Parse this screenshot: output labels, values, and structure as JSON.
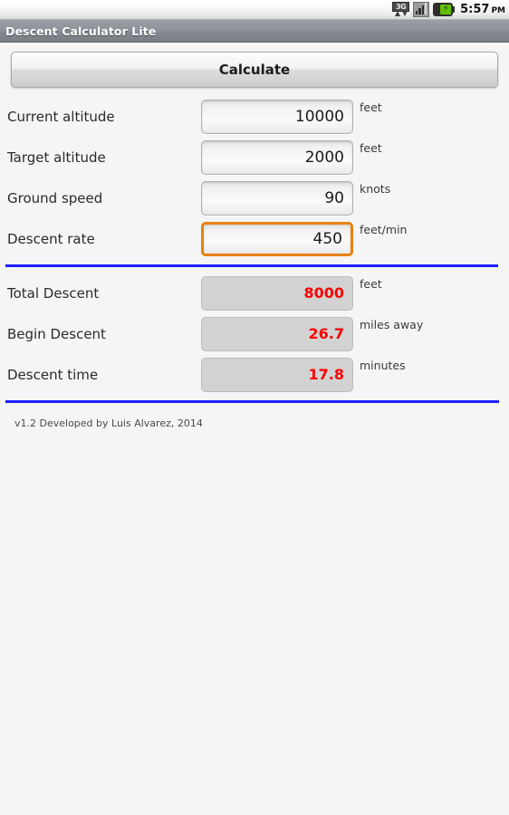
{
  "status_bar": {
    "network_label": "3G",
    "time": "5:57",
    "ampm": "PM",
    "icons": [
      "3g-data-icon",
      "signal-bars-icon",
      "battery-charging-icon"
    ]
  },
  "title_bar": {
    "title": "Descent Calculator Lite"
  },
  "toolbar": {
    "calculate_label": "Calculate"
  },
  "inputs": [
    {
      "label": "Current altitude",
      "value": "10000",
      "unit": "feet",
      "focused": false
    },
    {
      "label": "Target altitude",
      "value": "2000",
      "unit": "feet",
      "focused": false
    },
    {
      "label": "Ground speed",
      "value": "90",
      "unit": "knots",
      "focused": false
    },
    {
      "label": "Descent rate",
      "value": "450",
      "unit": "feet/min",
      "focused": true
    }
  ],
  "results": [
    {
      "label": "Total Descent",
      "value": "8000",
      "unit": "feet"
    },
    {
      "label": "Begin Descent",
      "value": "26.7",
      "unit": "miles away"
    },
    {
      "label": "Descent time",
      "value": "17.8",
      "unit": "minutes"
    }
  ],
  "footer": {
    "credit": "v1.2 Developed by Luis Alvarez, 2014"
  },
  "colors": {
    "accent_focus": "#e8820c",
    "divider": "#1f1fff",
    "result_value": "#f80000",
    "page_background": "#f5f5f5",
    "title_bar": "#82888e"
  }
}
